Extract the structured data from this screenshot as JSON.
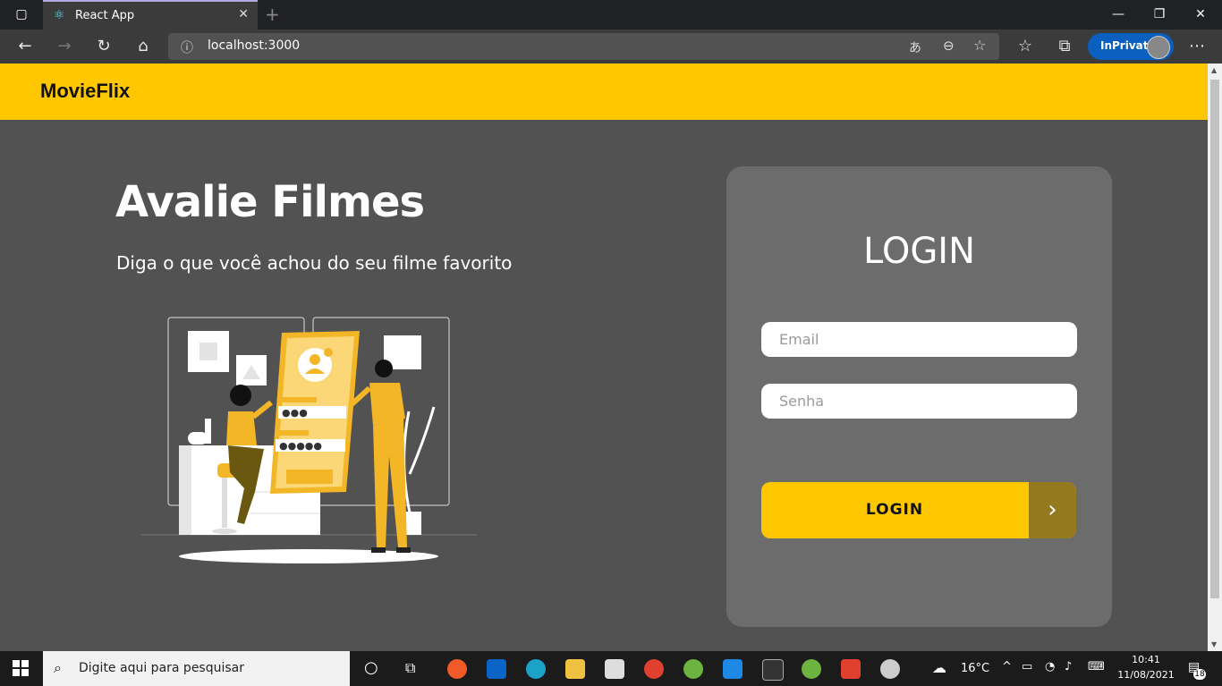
{
  "browser": {
    "tab_title": "React App",
    "url": "localhost:3000",
    "inprivate_label": "InPrivate"
  },
  "app": {
    "brand": "MovieFlix",
    "hero_title": "Avalie Filmes",
    "hero_subtitle": "Diga o que você achou do seu filme favorito"
  },
  "login": {
    "title": "LOGIN",
    "email_placeholder": "Email",
    "password_placeholder": "Senha",
    "button_label": "LOGIN",
    "button_arrow": "›"
  },
  "taskbar": {
    "search_placeholder": "Digite aqui para pesquisar",
    "temperature": "16°C",
    "time": "10:41",
    "date": "11/08/2021",
    "notification_count": "18"
  },
  "colors": {
    "accent": "#ffc700",
    "accent_dark": "#95791f",
    "background": "#525252",
    "card": "#6c6c6c"
  }
}
